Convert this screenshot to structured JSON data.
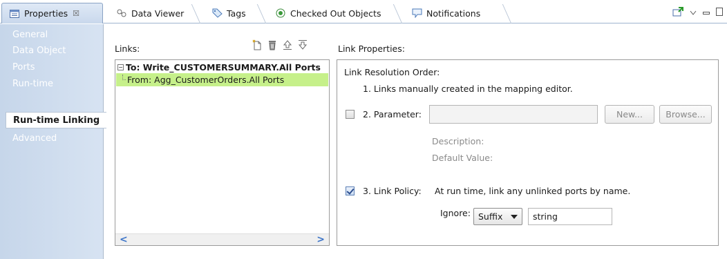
{
  "tabs": [
    {
      "label": "Properties",
      "icon": "properties-icon",
      "active": true,
      "close": "☒"
    },
    {
      "label": "Data Viewer",
      "icon": "data-viewer-icon"
    },
    {
      "label": "Tags",
      "icon": "tag-icon"
    },
    {
      "label": "Checked Out Objects",
      "icon": "checked-out-icon"
    },
    {
      "label": "Notifications",
      "icon": "notifications-icon"
    }
  ],
  "view_tools": [
    "pin-icon",
    "view-menu-icon",
    "minimize-icon",
    "maximize-icon"
  ],
  "nav": {
    "items": [
      "General",
      "Data Object",
      "Ports",
      "Run-time",
      "Run-time Linking",
      "Advanced"
    ],
    "selected": "Run-time Linking"
  },
  "links": {
    "label": "Links:",
    "tools": [
      "new-link-icon",
      "delete-icon",
      "move-up-icon",
      "move-down-icon"
    ],
    "root": "To: Write_CUSTOMERSUMMARY.All Ports",
    "root_toggle": "−",
    "child": "From: Agg_CustomerOrders.All Ports",
    "scroll_left": "<",
    "scroll_right": ">"
  },
  "link_properties": {
    "label": "Link Properties:",
    "order_title": "Link Resolution Order:",
    "item1": "1. Links manually created in the mapping editor.",
    "item2_label": "2. Parameter:",
    "item2_checked": false,
    "new_button": "New...",
    "browse_button": "Browse...",
    "description_label": "Description:",
    "default_value_label": "Default Value:",
    "item3_label": "3. Link Policy:",
    "item3_checked": true,
    "policy_text": "At run time, link any unlinked ports by name.",
    "ignore_label": "Ignore:",
    "ignore_option": "Suffix",
    "ignore_value": "string"
  },
  "colors": {
    "selected_row": "#c6f08a",
    "nav_bg": "#c6d6ea",
    "accent": "#3c74c8"
  }
}
